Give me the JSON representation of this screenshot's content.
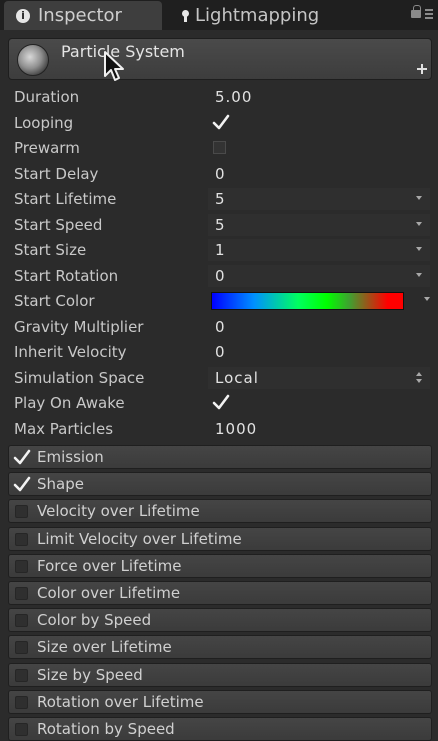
{
  "tabs": {
    "inspector": "Inspector",
    "lightmapping": "Lightmapping"
  },
  "component": {
    "title": "Particle System"
  },
  "properties": [
    {
      "label": "Duration",
      "value": "5.00",
      "kind": "value"
    },
    {
      "label": "Looping",
      "value": "",
      "kind": "checked"
    },
    {
      "label": "Prewarm",
      "value": "",
      "kind": "unchecked"
    },
    {
      "label": "Start Delay",
      "value": "0",
      "kind": "value"
    },
    {
      "label": "Start Lifetime",
      "value": "5",
      "kind": "dropdown"
    },
    {
      "label": "Start Speed",
      "value": "5",
      "kind": "dropdown"
    },
    {
      "label": "Start Size",
      "value": "1",
      "kind": "dropdown"
    },
    {
      "label": "Start Rotation",
      "value": "0",
      "kind": "dropdown"
    },
    {
      "label": "Start Color",
      "value": "",
      "kind": "gradient"
    },
    {
      "label": "Gravity Multiplier",
      "value": "0",
      "kind": "value"
    },
    {
      "label": "Inherit Velocity",
      "value": "0",
      "kind": "value"
    },
    {
      "label": "Simulation Space",
      "value": "Local",
      "kind": "enum"
    },
    {
      "label": "Play On Awake",
      "value": "",
      "kind": "checked"
    },
    {
      "label": "Max Particles",
      "value": "1000",
      "kind": "value"
    }
  ],
  "modules": [
    {
      "label": "Emission",
      "enabled": true
    },
    {
      "label": "Shape",
      "enabled": true
    },
    {
      "label": "Velocity over Lifetime",
      "enabled": false
    },
    {
      "label": "Limit Velocity over Lifetime",
      "enabled": false
    },
    {
      "label": "Force over Lifetime",
      "enabled": false
    },
    {
      "label": "Color over Lifetime",
      "enabled": false
    },
    {
      "label": "Color by Speed",
      "enabled": false
    },
    {
      "label": "Size over Lifetime",
      "enabled": false
    },
    {
      "label": "Size by Speed",
      "enabled": false
    },
    {
      "label": "Rotation over Lifetime",
      "enabled": false
    },
    {
      "label": "Rotation by Speed",
      "enabled": false
    }
  ],
  "colors": {
    "background": "#2b2b2b",
    "tab_active": "#3e3e3e",
    "text": "#d2d2d2"
  }
}
